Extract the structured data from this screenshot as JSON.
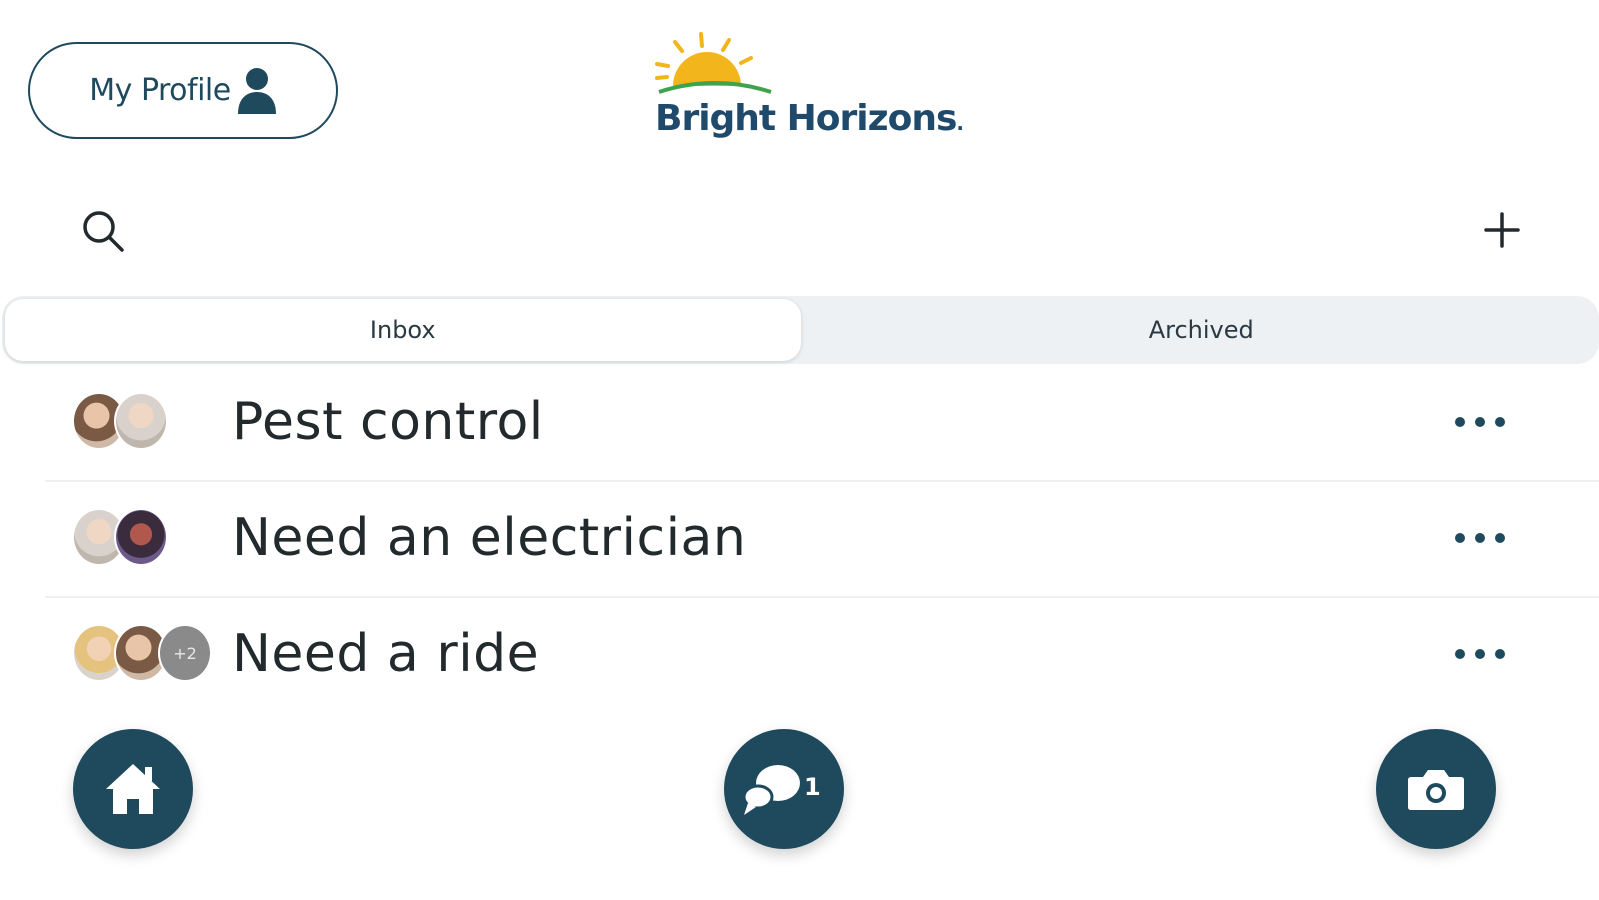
{
  "header": {
    "profile_label": "My Profile",
    "profile_icon": "person-icon",
    "logo_text": "Bright Horizons",
    "logo_mark": "."
  },
  "toolbar": {
    "search_icon": "search-icon",
    "add_icon": "plus-icon"
  },
  "tabs": [
    {
      "label": "Inbox",
      "active": true
    },
    {
      "label": "Archived",
      "active": false
    }
  ],
  "conversations": [
    {
      "title": "Pest control",
      "participants": 2,
      "extra_count": ""
    },
    {
      "title": "Need an electrician",
      "participants": 2,
      "extra_count": ""
    },
    {
      "title": "Need a ride",
      "participants": 2,
      "extra_count": "+2"
    }
  ],
  "bottom_nav": {
    "home_icon": "home-icon",
    "messages_icon": "chat-bubbles-icon",
    "messages_badge": "1",
    "camera_icon": "camera-icon"
  },
  "colors": {
    "primary": "#1f4a5e",
    "logo_blue": "#1f4a6b",
    "sun_yellow": "#f2b51c",
    "horizon_green": "#3fa34d",
    "tab_track": "#eef1f3"
  }
}
